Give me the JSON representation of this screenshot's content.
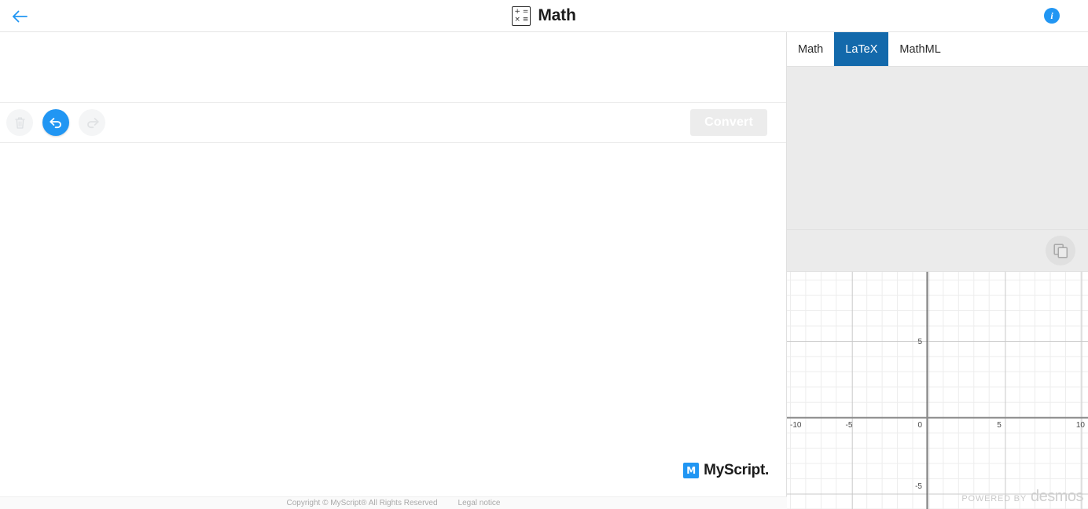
{
  "header": {
    "back_icon": "arrow-left-icon",
    "title": "Math",
    "app_icon": "math-symbols-icon",
    "icon_row_top": "+ =",
    "icon_row_bottom": "× ≡",
    "info_label": "i"
  },
  "toolbar": {
    "erase_icon": "trash-icon",
    "undo_icon": "undo-icon",
    "redo_icon": "redo-icon",
    "convert_label": "Convert"
  },
  "brand": {
    "mark": "M",
    "name": "MyScript."
  },
  "right_panel": {
    "tabs": [
      {
        "label": "Math",
        "active": false
      },
      {
        "label": "LaTeX",
        "active": true
      },
      {
        "label": "MathML",
        "active": false
      }
    ],
    "result_value": "",
    "copy_icon": "copy-icon"
  },
  "chart_data": {
    "type": "line",
    "title": "",
    "xlabel": "",
    "ylabel": "",
    "series": [],
    "x_ticks": [
      -10,
      -5,
      0,
      5,
      10
    ],
    "y_ticks": [
      5,
      0,
      -5
    ],
    "xlim": [
      -10,
      10
    ],
    "ylim": [
      -7.5,
      7.5
    ],
    "grid": true,
    "minor_step": 1,
    "major_step": 5,
    "credit_prefix": "POWERED BY",
    "credit_brand": "desmos"
  },
  "colors": {
    "accent_blue": "#2196f3",
    "tab_active_blue": "#1369ab",
    "panel_gray": "#ebebeb",
    "disabled_gray": "#ececec"
  },
  "footer": {
    "copyright": "Copyright © MyScript® All Rights Reserved",
    "legal": "Legal notice"
  }
}
